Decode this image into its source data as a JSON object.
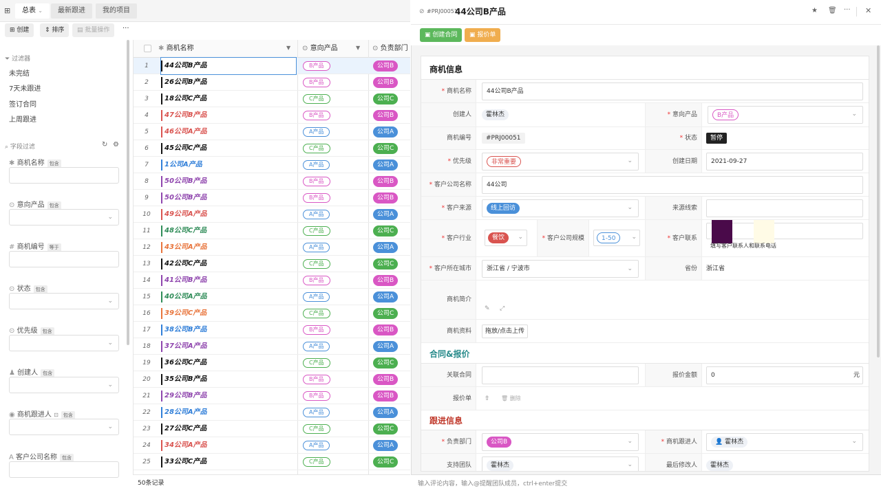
{
  "app_icon": "grid-icon",
  "tabs": [
    {
      "label": "总表"
    },
    {
      "label": "最新跟进"
    },
    {
      "label": "我的项目"
    }
  ],
  "toolbar": {
    "create": "创建",
    "sort": "排序",
    "batch": "批量操作",
    "more": "···"
  },
  "filter": {
    "title": "过滤器",
    "items": [
      "未完结",
      "7天未跟进",
      "签订合同",
      "上周跟进"
    ],
    "field_title": "字段过滤",
    "fields": [
      {
        "label": "商机名称",
        "tag": "包含"
      },
      {
        "label": "意向产品",
        "tag": "包含"
      },
      {
        "label": "商机编号",
        "tag": "等于"
      },
      {
        "label": "状态",
        "tag": "包含"
      },
      {
        "label": "优先级",
        "tag": "包含"
      },
      {
        "label": "创建人",
        "tag": "包含"
      },
      {
        "label": "商机跟进人",
        "tag": "包含"
      },
      {
        "label": "客户公司名称",
        "tag": "包含"
      }
    ]
  },
  "table": {
    "headers": {
      "name": "商机名称",
      "product": "意向产品",
      "dept": "负责部门"
    },
    "rows": [
      {
        "n": "1",
        "name": "44公司B产品",
        "p": "B产品",
        "d": "公司B"
      },
      {
        "n": "2",
        "name": "26公司B产品",
        "p": "B产品",
        "d": "公司B"
      },
      {
        "n": "3",
        "name": "18公司C产品",
        "p": "C产品",
        "d": "公司C"
      },
      {
        "n": "4",
        "name": "47公司B产品",
        "p": "B产品",
        "d": "公司B"
      },
      {
        "n": "5",
        "name": "46公司A产品",
        "p": "A产品",
        "d": "公司A"
      },
      {
        "n": "6",
        "name": "45公司C产品",
        "p": "C产品",
        "d": "公司C"
      },
      {
        "n": "7",
        "name": "1公司A产品",
        "p": "A产品",
        "d": "公司A"
      },
      {
        "n": "8",
        "name": "50公司B产品",
        "p": "B产品",
        "d": "公司B"
      },
      {
        "n": "9",
        "name": "50公司B产品",
        "p": "B产品",
        "d": "公司B"
      },
      {
        "n": "10",
        "name": "49公司A产品",
        "p": "A产品",
        "d": "公司A"
      },
      {
        "n": "11",
        "name": "48公司C产品",
        "p": "C产品",
        "d": "公司C"
      },
      {
        "n": "12",
        "name": "43公司A产品",
        "p": "A产品",
        "d": "公司A"
      },
      {
        "n": "13",
        "name": "42公司C产品",
        "p": "C产品",
        "d": "公司C"
      },
      {
        "n": "14",
        "name": "41公司B产品",
        "p": "B产品",
        "d": "公司B"
      },
      {
        "n": "15",
        "name": "40公司A产品",
        "p": "A产品",
        "d": "公司A"
      },
      {
        "n": "16",
        "name": "39公司C产品",
        "p": "C产品",
        "d": "公司C"
      },
      {
        "n": "17",
        "name": "38公司B产品",
        "p": "B产品",
        "d": "公司B"
      },
      {
        "n": "18",
        "name": "37公司A产品",
        "p": "A产品",
        "d": "公司A"
      },
      {
        "n": "19",
        "name": "36公司C产品",
        "p": "C产品",
        "d": "公司C"
      },
      {
        "n": "20",
        "name": "35公司B产品",
        "p": "B产品",
        "d": "公司B"
      },
      {
        "n": "21",
        "name": "29公司B产品",
        "p": "B产品",
        "d": "公司B"
      },
      {
        "n": "22",
        "name": "28公司A产品",
        "p": "A产品",
        "d": "公司A"
      },
      {
        "n": "23",
        "name": "27公司C产品",
        "p": "C产品",
        "d": "公司C"
      },
      {
        "n": "24",
        "name": "34公司A产品",
        "p": "A产品",
        "d": "公司A"
      },
      {
        "n": "25",
        "name": "33公司C产品",
        "p": "C产品",
        "d": "公司C"
      }
    ],
    "bar_colors": [
      "#111",
      "#111",
      "#111",
      "#d9534f",
      "#d9534f",
      "#111",
      "#2f7ed8",
      "#8e44ad",
      "#8e44ad",
      "#d9534f",
      "#2e8b57",
      "#e8743b",
      "#111",
      "#8e44ad",
      "#2e8b57",
      "#e8743b",
      "#2f7ed8",
      "#8e44ad",
      "#111",
      "#111",
      "#8e44ad",
      "#2f7ed8",
      "#111",
      "#d9534f",
      "#111"
    ],
    "footer": "50条记录"
  },
  "colors": {
    "A": "#4a90d9",
    "B": "#d957c4",
    "C": "#4caf50",
    "green": "#5cb85c",
    "orange": "#f0ad4e",
    "red": "#d9534f",
    "teal": "#2a8c8c",
    "darkred": "#c0392b"
  },
  "detail": {
    "code": "#PRJ00051",
    "title": "44公司B产品",
    "btn_contract": "创建合同",
    "btn_quote": "报价单",
    "sec1": "商机信息",
    "sec2": "合同&报价",
    "sec3": "跟进信息",
    "f_name": "商机名称",
    "v_name": "44公司B产品",
    "f_creator": "创建人",
    "v_creator": "霍林杰",
    "f_product": "意向产品",
    "v_product": "B产品",
    "f_code": "商机编号",
    "v_code": "#PRJ00051",
    "f_status": "状态",
    "v_status": "暂停",
    "f_priority": "优先级",
    "v_priority": "非常重要",
    "f_created": "创建日期",
    "v_created": "2021-09-27",
    "f_company": "客户公司名称",
    "v_company": "44公司",
    "f_source": "客户来源",
    "v_source": "线上回访",
    "f_clue": "来源线索",
    "f_industry": "客户行业",
    "v_industry": "餐饮",
    "f_scale": "客户公司规模",
    "v_scale": "1-50",
    "f_contact": "客户联系",
    "v_contact_hint": "填写客户联系人和联系电话",
    "f_city": "客户所在城市",
    "v_city": "浙江省 / 宁波市",
    "f_province": "省份",
    "v_province": "浙江省",
    "f_intro": "商机简介",
    "f_files": "商机资料",
    "v_files": "拖放/点击上传",
    "f_contract": "关联合同",
    "f_amount": "报价金额",
    "v_amount": "0",
    "v_unit": "元",
    "f_quote": "报价单",
    "v_delete": "删除",
    "f_dept": "负责部门",
    "v_dept": "公司B",
    "f_follower": "商机跟进人",
    "v_follower": "霍林杰",
    "f_team": "支持团队",
    "v_team": "霍林杰",
    "f_modifier": "最后修改人",
    "v_modifier": "霍林杰"
  },
  "comment_placeholder": "输入评论内容，输入@提醒团队成员，ctrl+enter提交"
}
